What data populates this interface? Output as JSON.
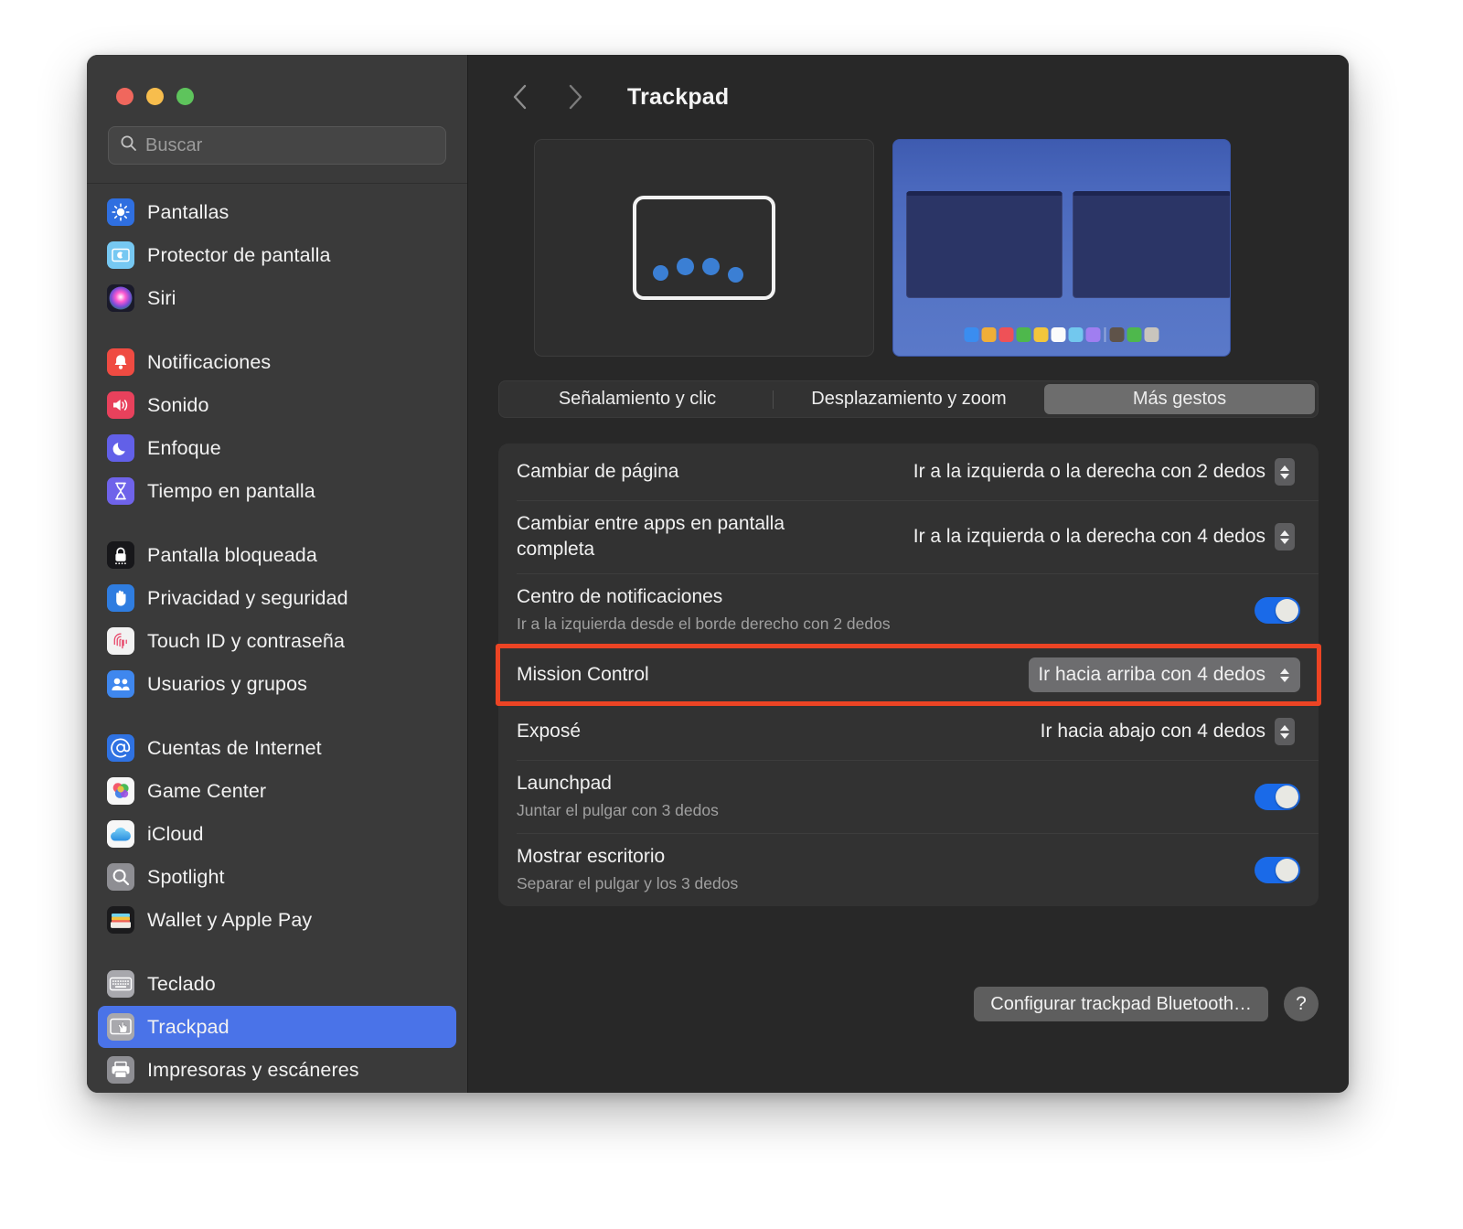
{
  "window": {
    "traffic_lights": [
      "close",
      "minimize",
      "zoom"
    ],
    "colors": {
      "close": "#f0675d",
      "minimize": "#f7bd4d",
      "zoom": "#5ec45c",
      "accent": "#4a73e8",
      "toggle_on": "#1a6ae8",
      "highlight": "#ec4424"
    }
  },
  "search": {
    "placeholder": "Buscar",
    "value": ""
  },
  "sidebar": {
    "groups": [
      {
        "items": [
          {
            "label": "Pantallas",
            "icon": "brightness-icon",
            "bg": "#2f6fe0"
          },
          {
            "label": "Protector de pantalla",
            "icon": "screensaver-icon",
            "bg": "#76c8f2"
          },
          {
            "label": "Siri",
            "icon": "siri-icon",
            "bg": "#1a1a2a"
          }
        ]
      },
      {
        "items": [
          {
            "label": "Notificaciones",
            "icon": "bell-icon",
            "bg": "#ef4b42"
          },
          {
            "label": "Sonido",
            "icon": "speaker-icon",
            "bg": "#e8415c"
          },
          {
            "label": "Enfoque",
            "icon": "moon-icon",
            "bg": "#6260e8"
          },
          {
            "label": "Tiempo en pantalla",
            "icon": "hourglass-icon",
            "bg": "#6f63ea"
          }
        ]
      },
      {
        "items": [
          {
            "label": "Pantalla bloqueada",
            "icon": "lock-icon",
            "bg": "#17171a"
          },
          {
            "label": "Privacidad y seguridad",
            "icon": "hand-icon",
            "bg": "#2f7de0"
          },
          {
            "label": "Touch ID y contraseña",
            "icon": "fingerprint-icon",
            "bg": "#f2f2f2"
          },
          {
            "label": "Usuarios y grupos",
            "icon": "users-icon",
            "bg": "#3f87ee"
          }
        ]
      },
      {
        "items": [
          {
            "label": "Cuentas de Internet",
            "icon": "at-icon",
            "bg": "#2f72e2"
          },
          {
            "label": "Game Center",
            "icon": "gamecenter-icon",
            "bg": "#f7f7f7"
          },
          {
            "label": "iCloud",
            "icon": "cloud-icon",
            "bg": "#f7f7f7"
          },
          {
            "label": "Spotlight",
            "icon": "search-icon",
            "bg": "#8e8e93"
          },
          {
            "label": "Wallet y Apple Pay",
            "icon": "wallet-icon",
            "bg": "#1b1b1d"
          }
        ]
      },
      {
        "items": [
          {
            "label": "Teclado",
            "icon": "keyboard-icon",
            "bg": "#a8a8ad"
          },
          {
            "label": "Trackpad",
            "icon": "trackpad-icon",
            "bg": "#a8a8ad",
            "selected": true
          },
          {
            "label": "Impresoras y escáneres",
            "icon": "printer-icon",
            "bg": "#8e8e93"
          }
        ]
      }
    ]
  },
  "main": {
    "title": "Trackpad",
    "nav": {
      "back": "back-chevron",
      "forward": "forward-chevron"
    },
    "preview": {
      "gesture": {
        "dots": 4,
        "description": "cuatro dedos en el trackpad"
      },
      "desktop": {
        "windows": 2,
        "dock_icons": [
          "#3a8df0",
          "#f0ae38",
          "#ef5157",
          "#4eb84c",
          "#f2c63c",
          "#fbfbfb",
          "#72c8ee",
          "#a07ef0",
          "divider",
          "#5f5349",
          "#4eb84c",
          "#c9c5bd"
        ]
      }
    },
    "tabs": [
      {
        "label": "Señalamiento y clic",
        "active": false
      },
      {
        "label": "Desplazamiento y zoom",
        "active": false
      },
      {
        "label": "Más gestos",
        "active": true
      }
    ],
    "settings": [
      {
        "title": "Cambiar de página",
        "subtitle": "",
        "control": "popup",
        "value": "Ir a la izquierda o la derecha con 2 dedos",
        "filled": false,
        "highlighted": false
      },
      {
        "title": "Cambiar entre apps en pantalla completa",
        "subtitle": "",
        "control": "popup",
        "value": "Ir a la izquierda o la derecha con 4 dedos",
        "filled": false,
        "highlighted": false
      },
      {
        "title": "Centro de notificaciones",
        "subtitle": "Ir a la izquierda desde el borde derecho con 2 dedos",
        "control": "toggle",
        "value": "on",
        "highlighted": false
      },
      {
        "title": "Mission Control",
        "subtitle": "",
        "control": "popup",
        "value": "Ir hacia arriba con 4 dedos",
        "filled": true,
        "highlighted": true
      },
      {
        "title": "Exposé",
        "subtitle": "",
        "control": "popup",
        "value": "Ir hacia abajo con 4 dedos",
        "filled": false,
        "highlighted": false
      },
      {
        "title": "Launchpad",
        "subtitle": "Juntar el pulgar con 3 dedos",
        "control": "toggle",
        "value": "on",
        "highlighted": false
      },
      {
        "title": "Mostrar escritorio",
        "subtitle": "Separar el pulgar y los 3 dedos",
        "control": "toggle",
        "value": "on",
        "highlighted": false
      }
    ],
    "footer": {
      "bluetooth_button": "Configurar trackpad Bluetooth…",
      "help_button": "?"
    }
  }
}
